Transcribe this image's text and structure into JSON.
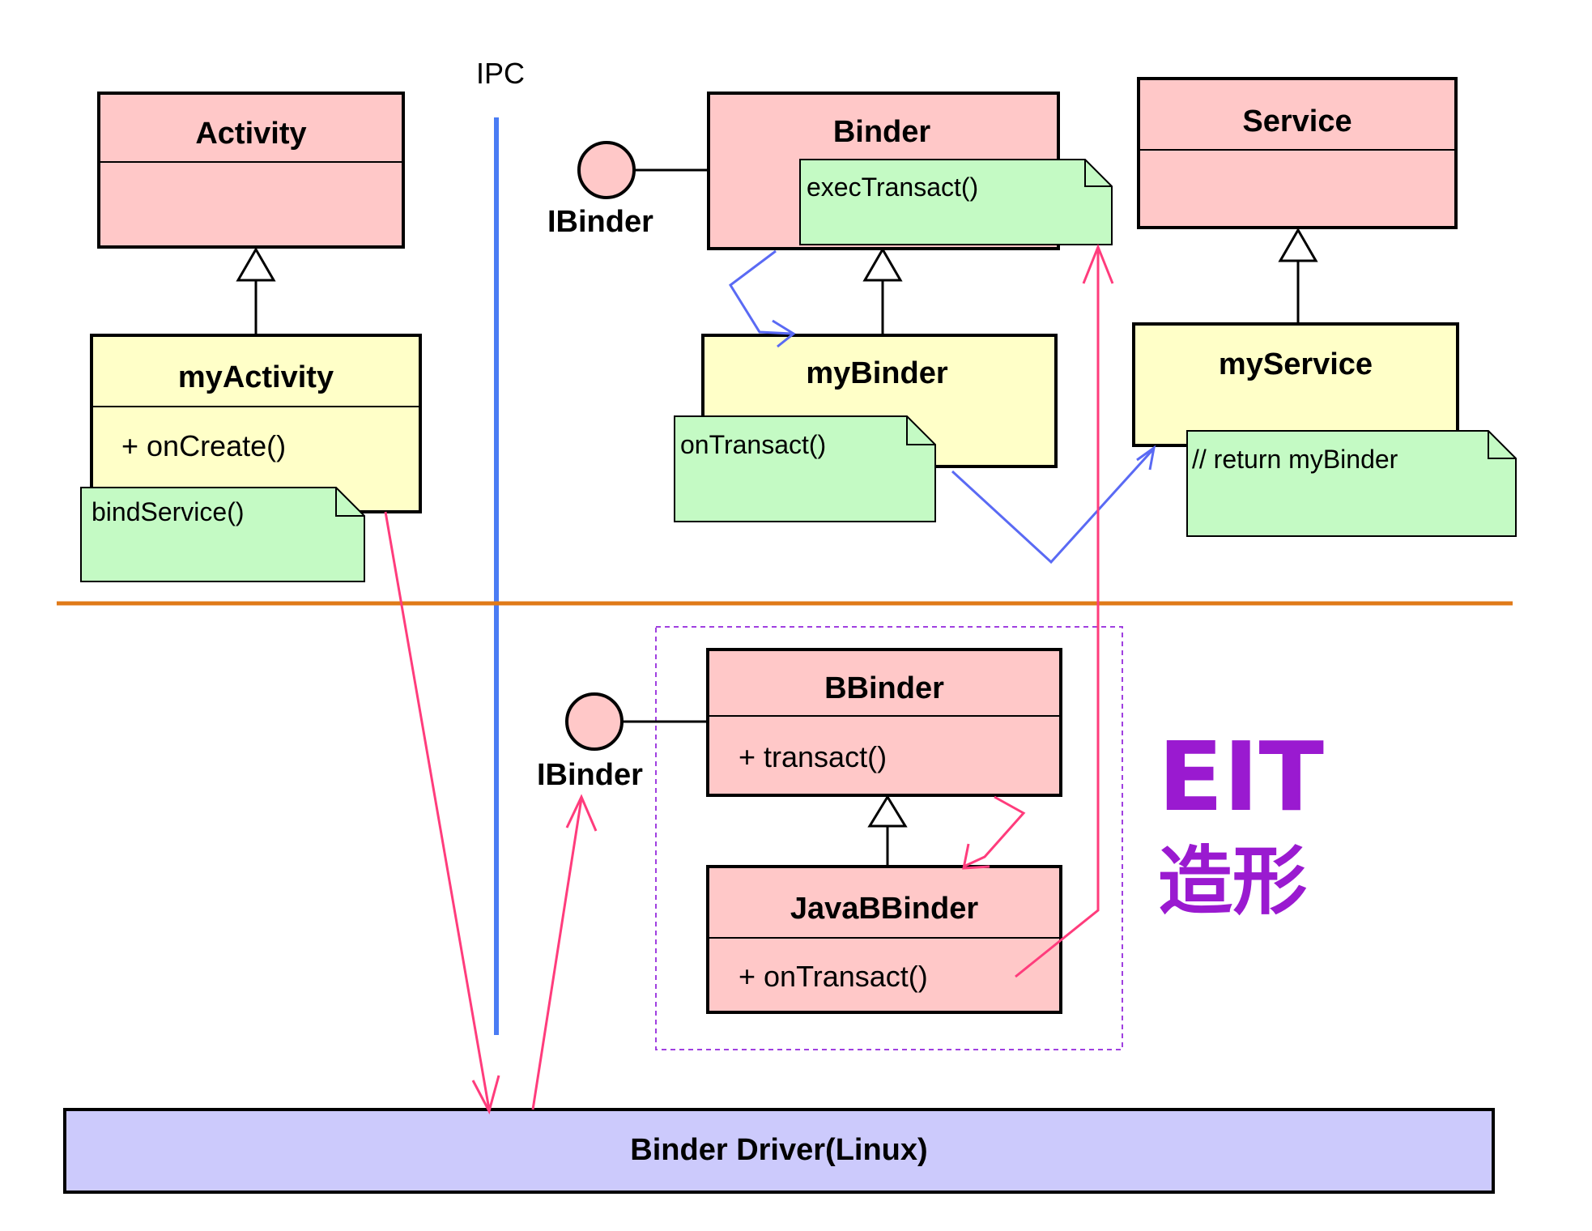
{
  "ipc_label": "IPC",
  "classes": {
    "activity": "Activity",
    "my_activity": "myActivity",
    "my_activity_method": "+ onCreate()",
    "binder": "Binder",
    "my_binder": "myBinder",
    "service": "Service",
    "my_service": "myService",
    "bbinder": "BBinder",
    "bbinder_method": "+ transact()",
    "java_bbinder": "JavaBBinder",
    "java_bbinder_method": "+ onTransact()",
    "binder_driver": "Binder Driver(Linux)"
  },
  "notes": {
    "bind_service": "bindService()",
    "exec_transact": "execTransact()",
    "on_transact": "onTransact()",
    "return_my_binder": "// return myBinder"
  },
  "interfaces": {
    "top": "IBinder",
    "bottom": "IBinder"
  },
  "eit": {
    "title": "EIT",
    "subtitle": "造形"
  },
  "colors": {
    "pink_class": "#ffc8c8",
    "yellow_class": "#ffffc8",
    "green_note": "#c4fac4",
    "driver": "#cccafc",
    "ipc_line": "#4a7cf4",
    "separator": "#e07a18",
    "pink_arrow": "#ff3c7c",
    "blue_arrow": "#5a6af4",
    "eit_purple": "#9a1ad0"
  }
}
